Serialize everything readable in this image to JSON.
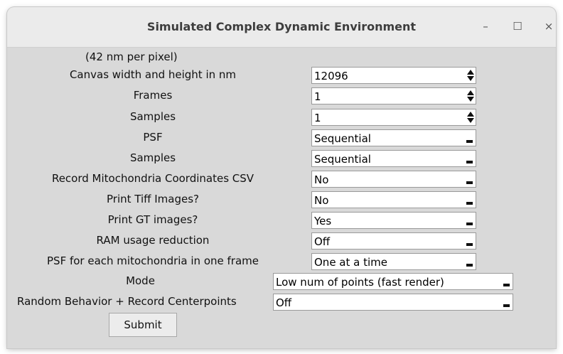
{
  "window": {
    "title": "Simulated Complex Dynamic Environment",
    "controls": {
      "minimize": "–",
      "maximize": "☐",
      "close": "×"
    }
  },
  "form": {
    "scale_note": "(42 nm per pixel)",
    "rows": [
      {
        "label": "Canvas width and height in nm",
        "value": "12096",
        "kind": "spinner"
      },
      {
        "label": "Frames",
        "value": "1",
        "kind": "spinner"
      },
      {
        "label": "Samples",
        "value": "1",
        "kind": "spinner"
      },
      {
        "label": "PSF",
        "value": "Sequential",
        "kind": "dropdown"
      },
      {
        "label": "Samples",
        "value": "Sequential",
        "kind": "dropdown"
      },
      {
        "label": "Record Mitochondria Coordinates CSV",
        "value": "No",
        "kind": "dropdown"
      },
      {
        "label": "Print Tiff Images?",
        "value": "No",
        "kind": "dropdown"
      },
      {
        "label": "Print GT images?",
        "value": "Yes",
        "kind": "dropdown"
      },
      {
        "label": "RAM usage reduction",
        "value": "Off",
        "kind": "dropdown"
      },
      {
        "label": "PSF for each mitochondria in one frame",
        "value": "One at a time",
        "kind": "dropdown"
      },
      {
        "label": "Mode",
        "value": "Low num of points (fast render)",
        "kind": "dropdown"
      },
      {
        "label": "Random Behavior + Record Centerpoints",
        "value": "Off",
        "kind": "dropdown"
      }
    ],
    "submit_label": "Submit"
  }
}
